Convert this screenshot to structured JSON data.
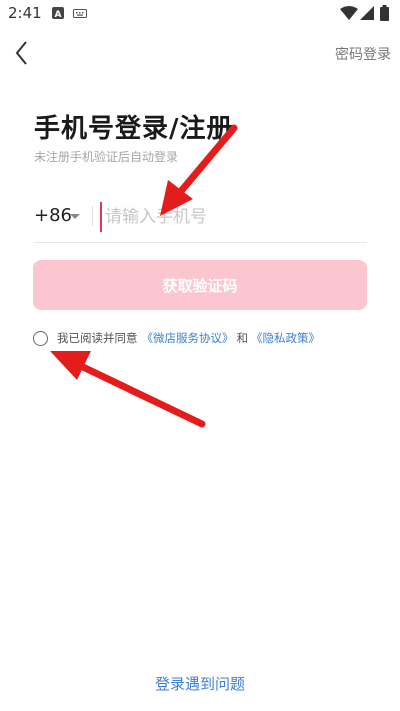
{
  "status_bar": {
    "time": "2:41",
    "icons": [
      "notification-a-icon",
      "keyboard-icon",
      "wifi-icon",
      "cellular-icon",
      "battery-icon"
    ]
  },
  "top_bar": {
    "back_icon": "chevron-left-icon",
    "password_login_label": "密码登录"
  },
  "main": {
    "title": "手机号登录/注册",
    "subtitle": "未注册手机验证后自动登录",
    "country_code": "+86",
    "phone_placeholder": "请输入手机号",
    "phone_value": "",
    "get_code_label": "获取验证码",
    "agreement": {
      "prefix": "我已阅读并同意",
      "service_link": "《微店服务协议》",
      "conjunction": "和",
      "privacy_link": "《隐私政策》"
    }
  },
  "footer": {
    "help_label": "登录遇到问题"
  },
  "colors": {
    "accent": "#fbc6d0",
    "link": "#3b7fd6",
    "annotation_arrow": "#e51c1c"
  }
}
